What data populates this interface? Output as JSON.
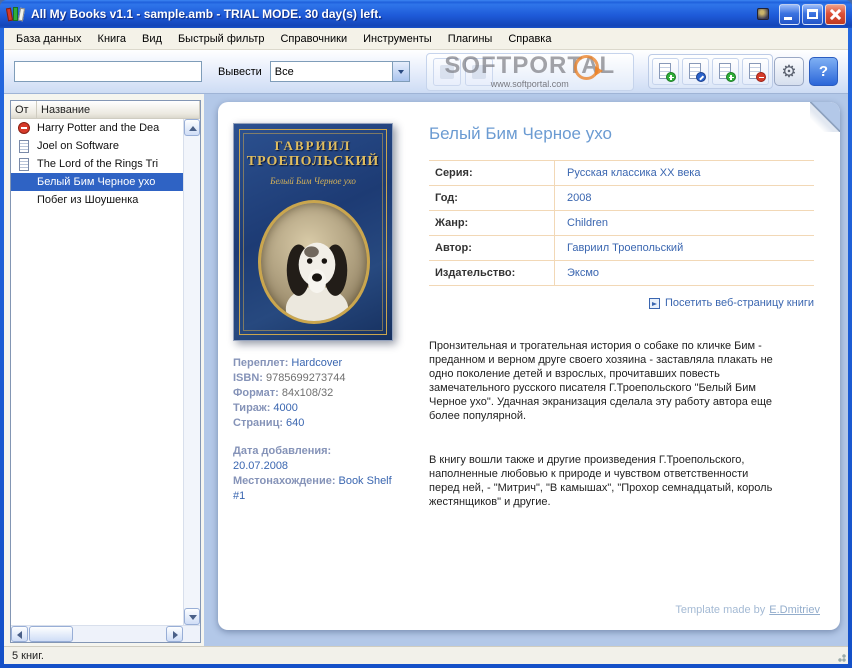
{
  "window": {
    "title": "All My Books v1.1 - sample.amb - TRIAL MODE. 30 day(s) left."
  },
  "menu": {
    "items": [
      "База данных",
      "Книга",
      "Вид",
      "Быстрый фильтр",
      "Справочники",
      "Инструменты",
      "Плагины",
      "Справка"
    ]
  },
  "toolbar": {
    "search_value": "",
    "filter_label": "Вывести",
    "filter_value": "Все",
    "icons": {
      "gear": "⚙",
      "help": "?"
    }
  },
  "watermark": {
    "text": "SOFTPORTAL",
    "url": "www.softportal.com"
  },
  "list": {
    "columns": [
      "От",
      "Название"
    ],
    "rows": [
      {
        "title": "Harry Potter and the Dea",
        "icon": "restricted-icon"
      },
      {
        "title": "Joel on Software",
        "icon": "book-icon"
      },
      {
        "title": "The Lord of the Rings Tri",
        "icon": "book-icon"
      },
      {
        "title": "Белый Бим Черное ухо",
        "icon": "",
        "selected": true
      },
      {
        "title": "Побег из Шоушенка",
        "icon": ""
      }
    ]
  },
  "status": {
    "text": "5 книг."
  },
  "cover": {
    "author_line1": "ГАВРИИЛ",
    "author_line2": "ТРОЕПОЛЬСКИЙ",
    "subtitle": "Белый Бим Черное ухо"
  },
  "book_info": {
    "items": [
      {
        "label": "Переплет:",
        "value": "Hardcover"
      },
      {
        "label": "ISBN:",
        "value": "9785699273744"
      },
      {
        "label": "Формат:",
        "value": "84x108/32"
      },
      {
        "label": "Тираж:",
        "value": "4000"
      },
      {
        "label": "Страниц:",
        "value": "640"
      }
    ],
    "added_label": "Дата добавления:",
    "added_value": "20.07.2008",
    "location_label": "Местонахождение:",
    "location_value": "Book Shelf #1"
  },
  "detail": {
    "title": "Белый Бим Черное ухо",
    "fields": [
      {
        "label": "Серия:",
        "value": "Русская классика XX века"
      },
      {
        "label": "Год:",
        "value": "2008"
      },
      {
        "label": "Жанр:",
        "value": "Children"
      },
      {
        "label": "Автор:",
        "value": "Гавриил Троепольский"
      },
      {
        "label": "Издательство:",
        "value": "Эксмо"
      }
    ],
    "weblink": "Посетить веб-страницу книги",
    "description1": "Пронзительная и трогательная история о собаке по кличке Бим - преданном и верном друге своего хозяина - заставляла плакать не одно поколение детей и взрослых, прочитавших повесть замечательного русского писателя Г.Троепольского \"Белый Бим Черное ухо\". Удачная экранизация сделала эту работу автора еще более популярной.",
    "description2": "В книгу вошли также и другие произведения Г.Троепольского, наполненные любовью к природе и чувством ответственности перед ней, - \"Митрич\", \"В камышах\", \"Прохор семнадцатый, король жестянщиков\" и другие.",
    "credit_prefix": "Template made by",
    "credit_link": "E.Dmitriev"
  },
  "colors": {
    "selection": "#2f63c4",
    "title_blue": "#6b9bd2",
    "link_blue": "#3a66b0",
    "table_border": "#f2d8b6",
    "page_background": "#b3c8e8"
  }
}
